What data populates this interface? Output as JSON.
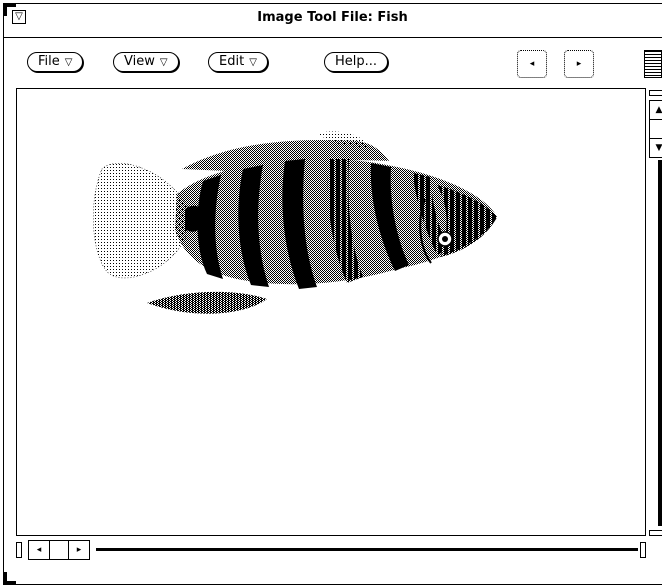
{
  "window": {
    "title": "Image Tool File: Fish",
    "menu_glyph": "▽"
  },
  "toolbar": {
    "file_label": "File",
    "view_label": "View",
    "edit_label": "Edit",
    "help_label": "Help...",
    "menu_indicator": "▽",
    "prev_page_glyph": "◂",
    "next_page_glyph": "▸"
  },
  "canvas": {
    "image_subject": "fish",
    "ink_color": "#000000",
    "paper_color": "#ffffff"
  },
  "scrollbars": {
    "up_glyph": "▲",
    "down_glyph": "▼",
    "left_glyph": "◂",
    "right_glyph": "▸"
  }
}
